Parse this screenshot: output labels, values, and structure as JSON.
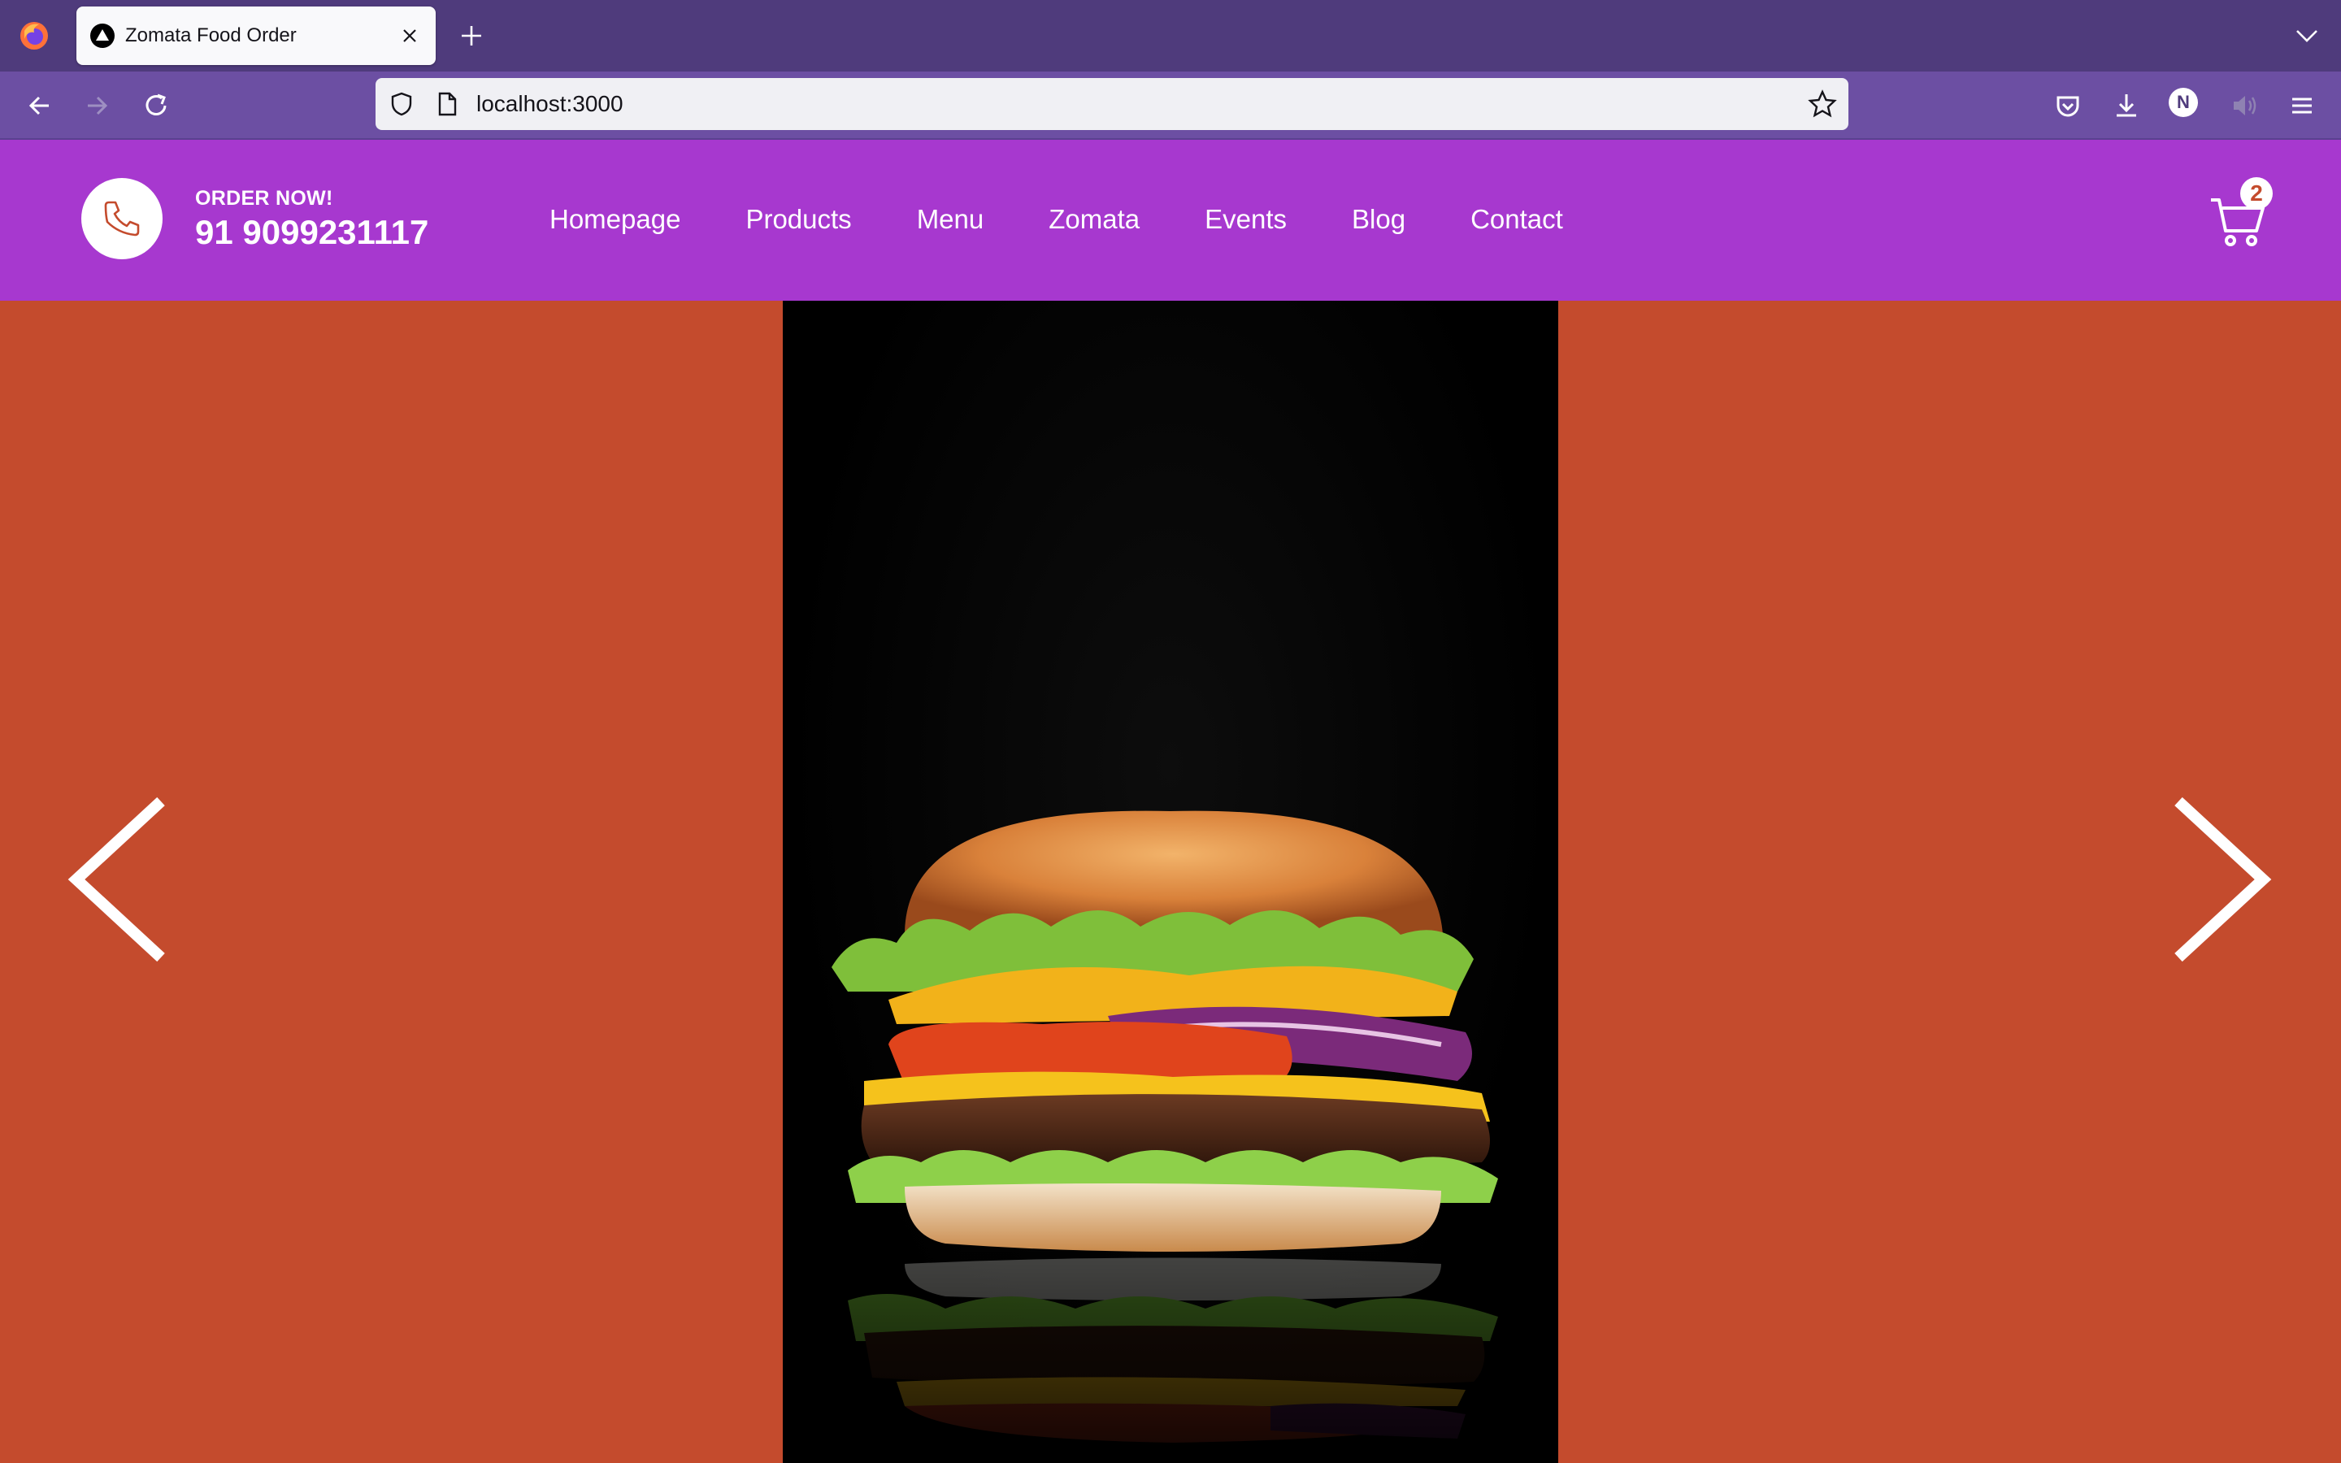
{
  "browser": {
    "tab_title": "Zomata Food Order",
    "url": "localhost:3000",
    "profile_initial": "N"
  },
  "header": {
    "order_label": "ORDER NOW!",
    "phone": "91 9099231117",
    "nav": [
      "Homepage",
      "Products",
      "Menu",
      "Zomata",
      "Events",
      "Blog",
      "Contact"
    ],
    "cart_count": "2"
  },
  "hero": {
    "image_subject": "burger",
    "background_color": "#c44b2d"
  },
  "colors": {
    "header_bg": "#a738cf",
    "accent": "#c44b2d",
    "browser_chrome": "#4f3b7c"
  }
}
